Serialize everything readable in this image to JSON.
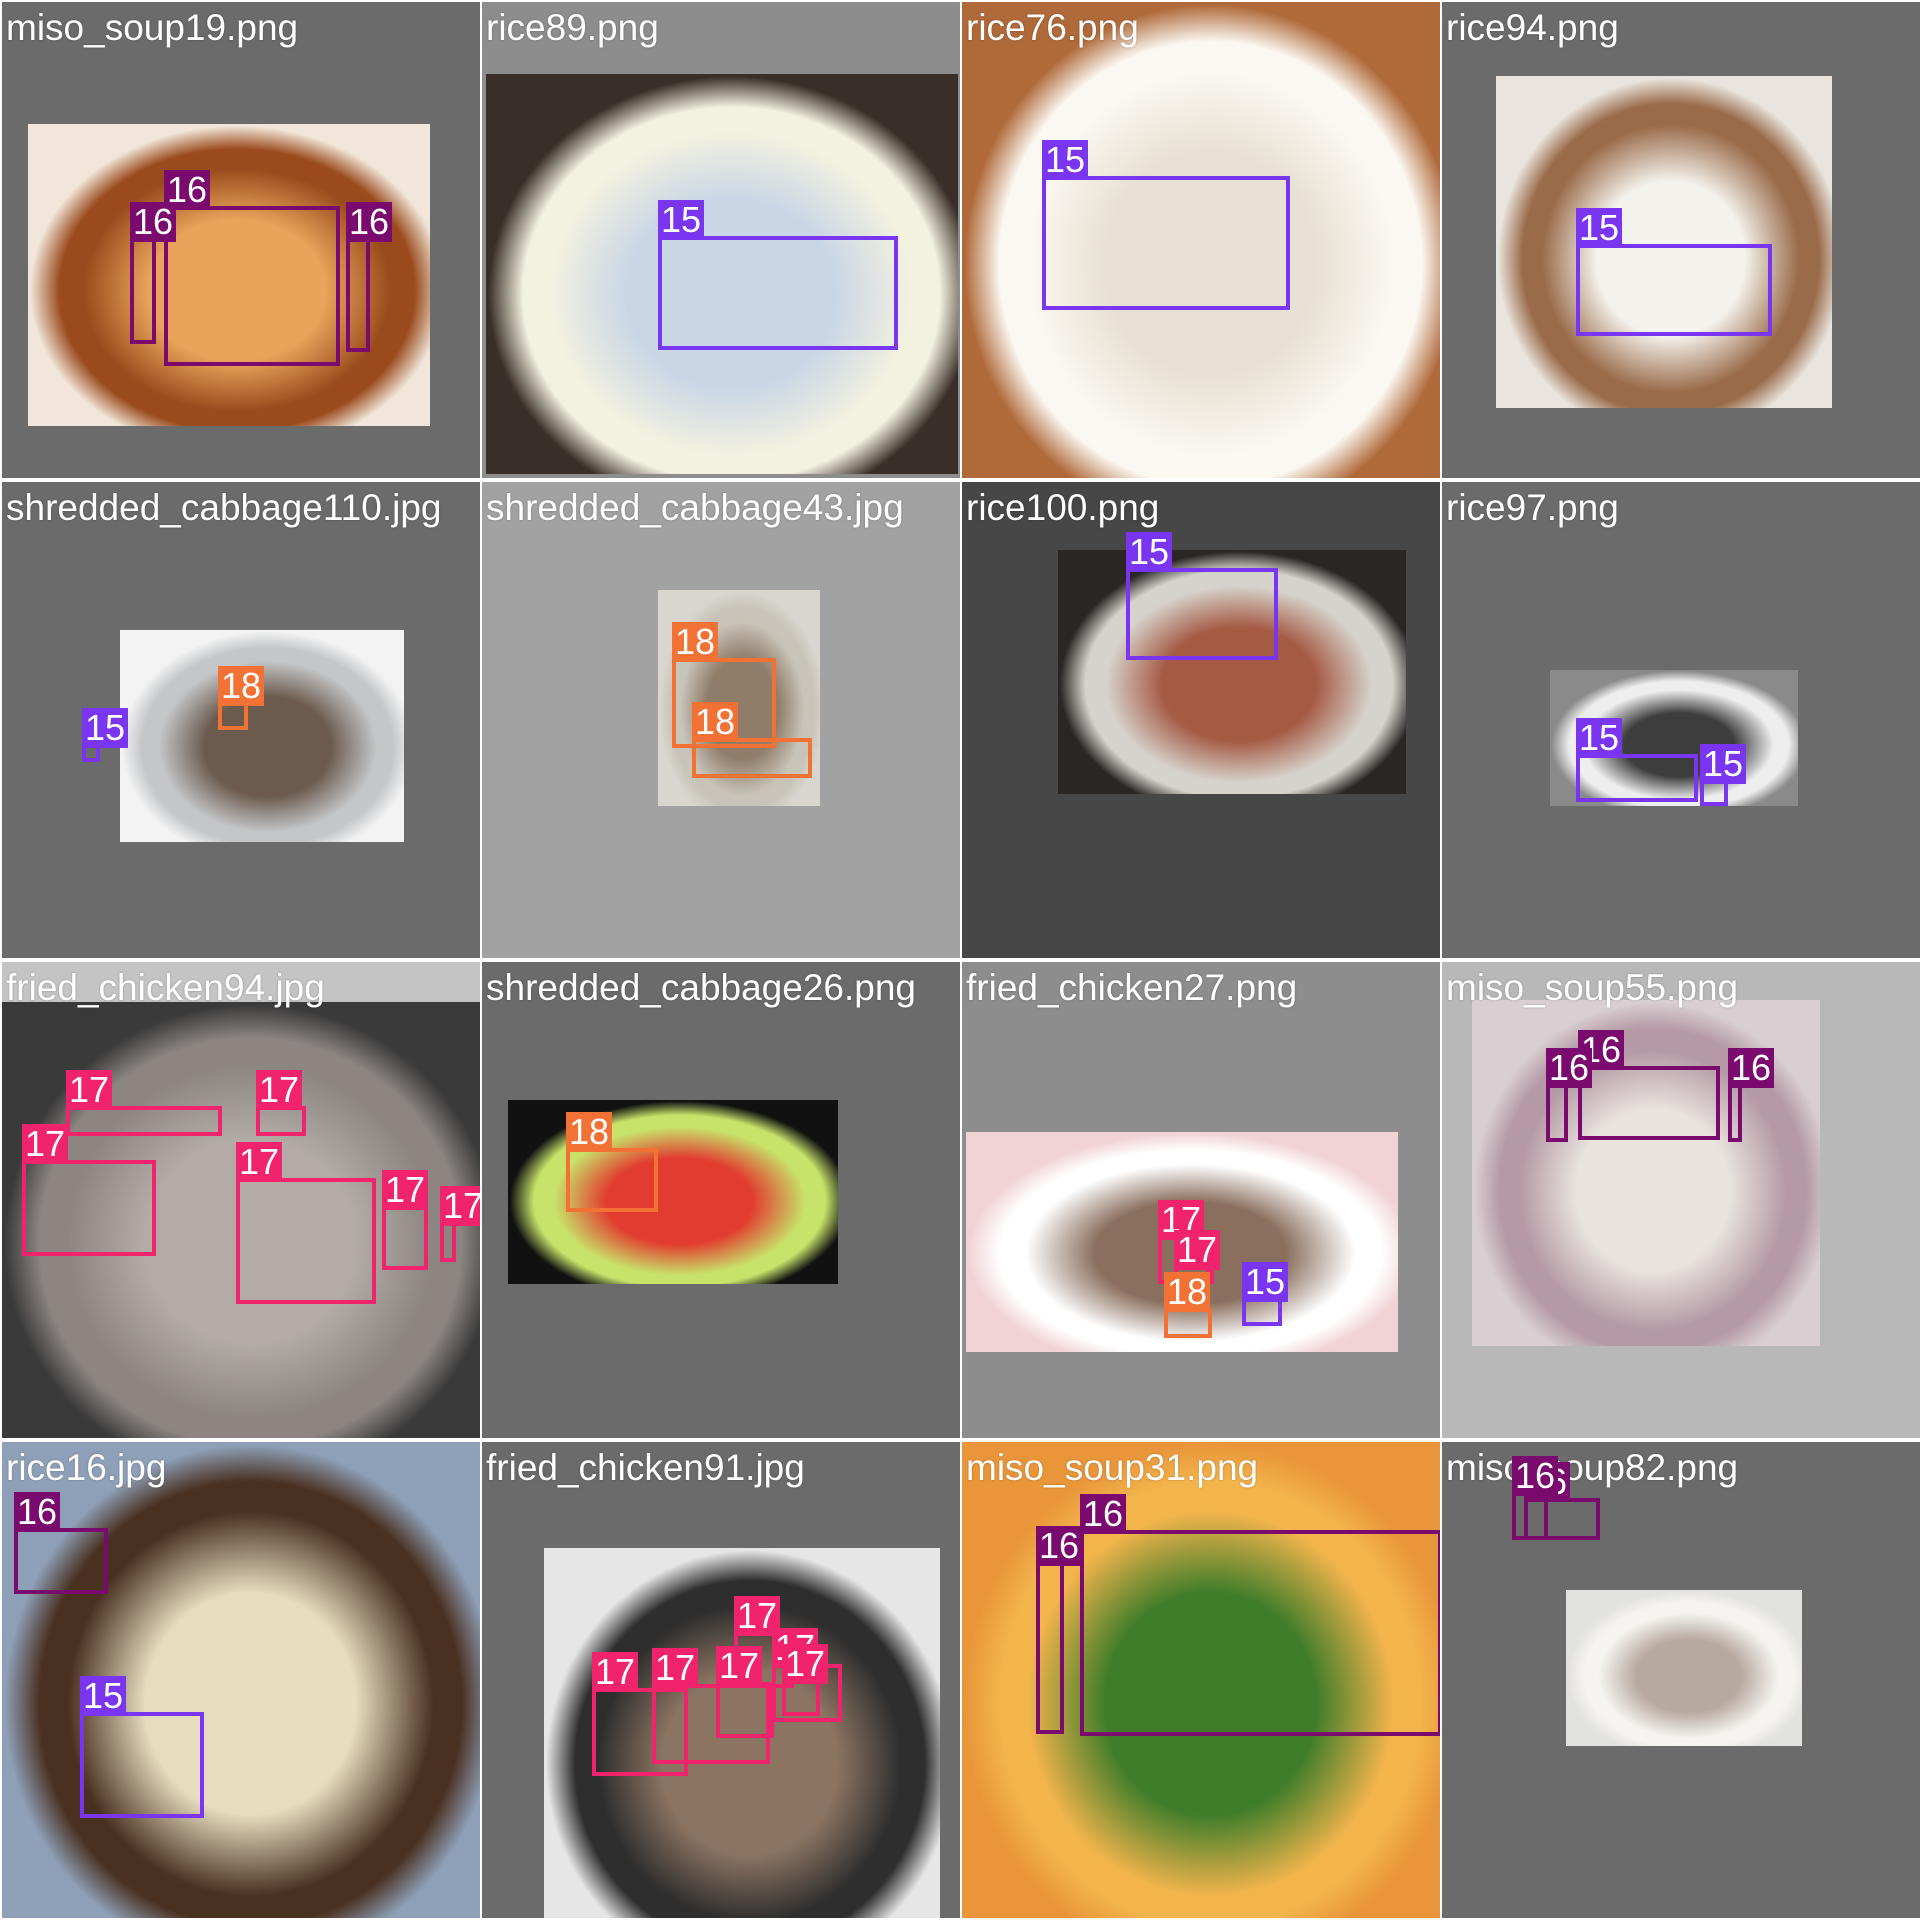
{
  "class_colors": {
    "15": "#7a35f0",
    "16": "#7b0a6e",
    "17": "#f0236c",
    "18": "#f27236"
  },
  "tiles": [
    {
      "filename": "miso_soup19.png",
      "bg": "#6b6b6b",
      "photo_colors": [
        "#f1e6d9",
        "#9a4a1c",
        "#e9a35a"
      ],
      "thumbnail": "miso soup in red bowl with tofu and wakame",
      "detections": [
        16,
        16,
        16
      ]
    },
    {
      "filename": "rice89.png",
      "bg": "#8d8d8d",
      "photo_colors": [
        "#3a2e28",
        "#f3f1e0",
        "#c9d6e6"
      ],
      "thumbnail": "bowl of white rice on dark table",
      "detections": [
        15
      ]
    },
    {
      "filename": "rice76.png",
      "bg": "#b8b8b8",
      "photo_colors": [
        "#b06a3a",
        "#fbf8f2",
        "#e7e1d3"
      ],
      "thumbnail": "close-up of white rice in white bowl",
      "detections": [
        15
      ]
    },
    {
      "filename": "rice94.png",
      "bg": "#6b6b6b",
      "photo_colors": [
        "#e9e5de",
        "#9a6b4a",
        "#f4f2ec"
      ],
      "thumbnail": "rice advertisement with bag of rice",
      "detections": [
        15
      ]
    },
    {
      "filename": "shredded_cabbage110.jpg",
      "bg": "#6b6b6b",
      "photo_colors": [
        "#f3f3f3",
        "#c4c6c8",
        "#6b5a4d"
      ],
      "thumbnail": "meal tray on white table",
      "detections": [
        18,
        15
      ]
    },
    {
      "filename": "shredded_cabbage43.jpg",
      "bg": "#a2a2a2",
      "photo_colors": [
        "#d8d6cf",
        "#c9c4b9",
        "#8f7d6a"
      ],
      "thumbnail": "shredded cabbage on foil",
      "detections": [
        18,
        18
      ]
    },
    {
      "filename": "rice100.png",
      "bg": "#474747",
      "photo_colors": [
        "#2a2624",
        "#d6d3cc",
        "#a55a44"
      ],
      "thumbnail": "rice in round pot",
      "detections": [
        15
      ]
    },
    {
      "filename": "rice97.png",
      "bg": "#6b6b6b",
      "photo_colors": [
        "#8a8a8a",
        "#eeeeee",
        "#3d3d3d"
      ],
      "thumbnail": "yakiniku rice bowl banner",
      "detections": [
        15,
        15
      ]
    },
    {
      "filename": "fried_chicken94.jpg",
      "bg": "#c4c4c4",
      "photo_colors": [
        "#3a3a3a",
        "#8c8582",
        "#b2aba6"
      ],
      "thumbnail": "fried chicken in black plastic container",
      "detections": [
        17,
        17,
        17,
        17,
        17,
        17
      ]
    },
    {
      "filename": "shredded_cabbage26.png",
      "bg": "#6b6b6b",
      "photo_colors": [
        "#111111",
        "#c8e36a",
        "#e23b2f"
      ],
      "thumbnail": "bowl of shredded cabbage with red text",
      "detections": [
        18
      ]
    },
    {
      "filename": "fried_chicken27.png",
      "bg": "#8d8d8d",
      "photo_colors": [
        "#f1d3d6",
        "#ffffff",
        "#8a6f5e"
      ],
      "thumbnail": "pink fried chicken menu advertisement",
      "detections": [
        17,
        17,
        18,
        15
      ]
    },
    {
      "filename": "miso_soup55.png",
      "bg": "#b8b8b8",
      "photo_colors": [
        "#d9cfd2",
        "#b59aa5",
        "#e8e3de"
      ],
      "thumbnail": "miso soup in pink bowl with chopsticks",
      "detections": [
        16,
        16,
        16
      ]
    },
    {
      "filename": "rice16.jpg",
      "bg": "#6b6b6b",
      "photo_colors": [
        "#8ea0b8",
        "#4a3020",
        "#e6dcc0"
      ],
      "thumbnail": "tray with rice, miso soup and fried chicken",
      "detections": [
        16,
        15
      ]
    },
    {
      "filename": "fried_chicken91.jpg",
      "bg": "#6b6b6b",
      "photo_colors": [
        "#e6e6e6",
        "#2e2e2e",
        "#8c7462"
      ],
      "thumbnail": "fried chicken pieces in black container",
      "detections": [
        17,
        17,
        17,
        17,
        17,
        17
      ]
    },
    {
      "filename": "miso_soup31.png",
      "bg": "#c58844",
      "photo_colors": [
        "#e9963a",
        "#f3b44c",
        "#3f7d2a"
      ],
      "thumbnail": "close-up miso soup with vegetables",
      "detections": [
        16,
        16
      ]
    },
    {
      "filename": "miso_soup82.png",
      "bg": "#6b6b6b",
      "photo_colors": [
        "#e2e2e0",
        "#f6f4f0",
        "#b7a9a0"
      ],
      "thumbnail": "small bowl of miso soup on striped cloth",
      "detections": [
        16,
        16
      ]
    }
  ]
}
